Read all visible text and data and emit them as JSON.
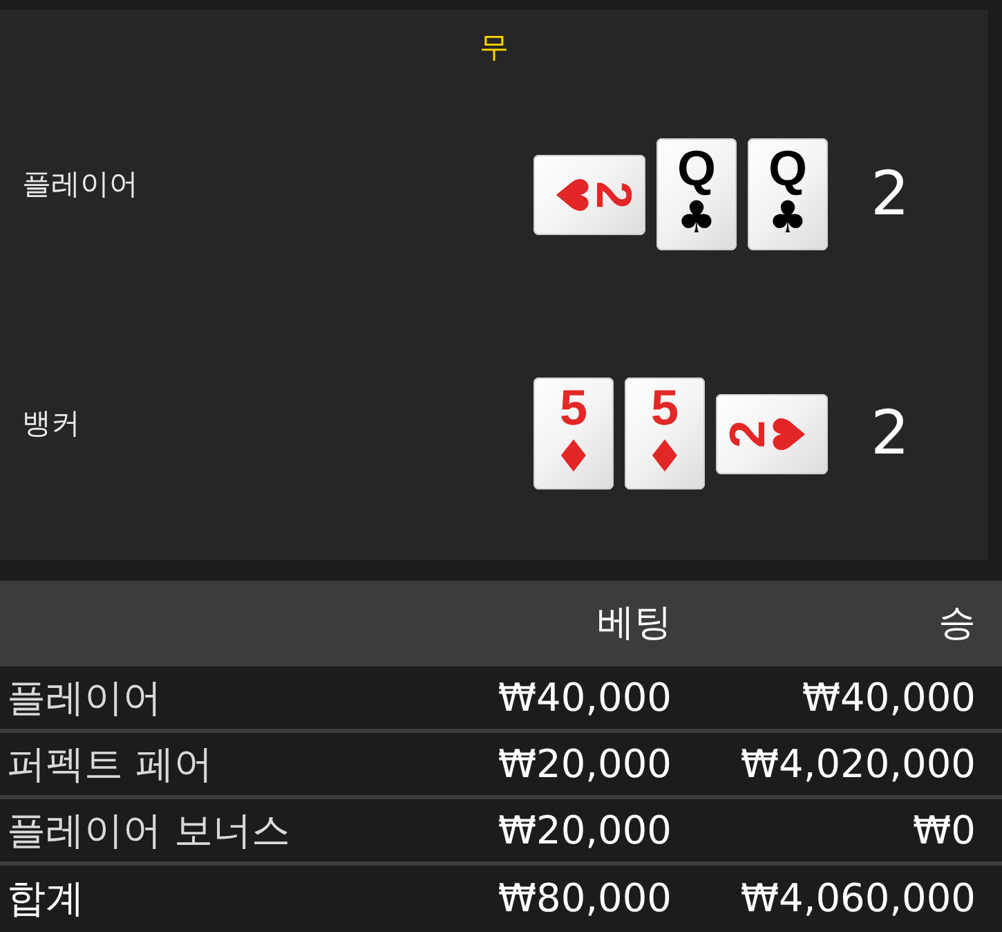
{
  "outcome": "무",
  "hands": [
    {
      "label": "플레이어",
      "score": "2",
      "cards": [
        {
          "kind": "rightward",
          "rank": "2",
          "suit": "♥",
          "color": "#e32626"
        },
        {
          "kind": "upright",
          "rank": "Q",
          "suit": "♣",
          "color": "#000000"
        },
        {
          "kind": "upright",
          "rank": "Q",
          "suit": "♣",
          "color": "#000000"
        }
      ]
    },
    {
      "label": "뱅커",
      "score": "2",
      "cards": [
        {
          "kind": "upright",
          "rank": "5",
          "suit": "♦",
          "color": "#e32626"
        },
        {
          "kind": "upright",
          "rank": "5",
          "suit": "♦",
          "color": "#e32626"
        },
        {
          "kind": "leftward",
          "rank": "2",
          "suit": "♥",
          "color": "#e32626"
        }
      ]
    }
  ],
  "bets_table": {
    "columns": [
      "베팅",
      "승"
    ],
    "rows": [
      {
        "kind": "bet",
        "label": "플레이어",
        "bet": "₩40,000",
        "win": "₩40,000"
      },
      {
        "kind": "bet",
        "label": "퍼펙트 페어",
        "bet": "₩20,000",
        "win": "₩4,020,000"
      },
      {
        "kind": "bet",
        "label": "플레이어 보너스",
        "bet": "₩20,000",
        "win": "₩0"
      },
      {
        "kind": "total",
        "label": "합계",
        "bet": "₩80,000",
        "win": "₩4,060,000"
      }
    ]
  }
}
